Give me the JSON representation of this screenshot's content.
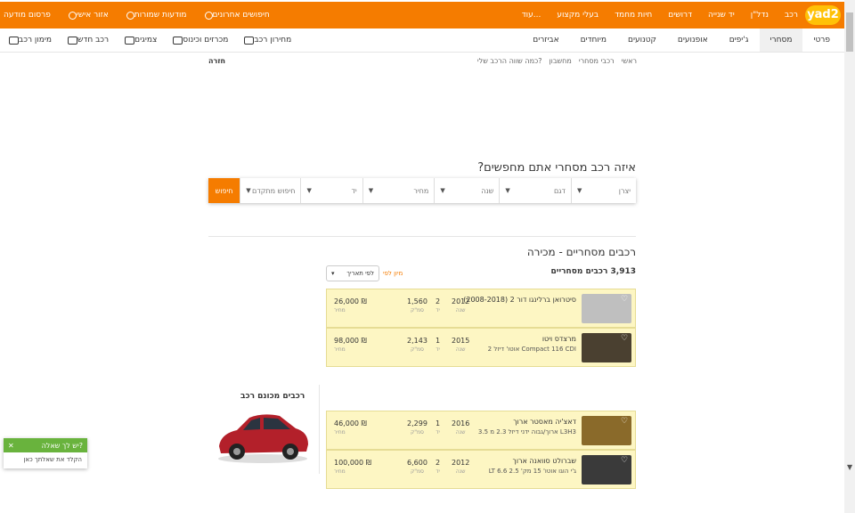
{
  "topbar": {
    "logo": "yad2",
    "nav": [
      "רכב",
      "נדל\"ן",
      "יד שנייה",
      "דרושים",
      "חיות מחמד",
      "בעלי מקצוע",
      "עוד..."
    ],
    "left": [
      {
        "label": "פרסום מודעה",
        "icon": "plus-icon"
      },
      {
        "label": "אזור אישי",
        "icon": "user-icon"
      },
      {
        "label": "מודעות שמורות",
        "icon": "heart-icon"
      },
      {
        "label": "חיפושים אחרונים",
        "icon": "history-icon"
      }
    ]
  },
  "subnav": {
    "tabs": [
      "פרטי",
      "מסחרי",
      "ג'יפים",
      "אופנועים",
      "קטנועים",
      "מיוחדים",
      "אביזרים"
    ],
    "active": 1,
    "tools": [
      {
        "label": "מימון רכב",
        "icon": "calculator-icon"
      },
      {
        "label": "רכב חדש",
        "icon": "car-icon"
      },
      {
        "label": "צמיגים",
        "icon": "tire-icon"
      },
      {
        "label": "מכרזים וכינוס",
        "icon": "gavel-icon"
      },
      {
        "label": "מחירון רכב",
        "icon": "pricelist-icon"
      }
    ]
  },
  "breadcrumb": [
    "ראשי",
    "רכבי מסחרי",
    "מחשבון",
    "כמה שווה הרכב שלי?"
  ],
  "back": "חזרה",
  "search": {
    "title": "איזה רכב מסחרי אתם מחפשים?",
    "fields": [
      {
        "label": "יצרן",
        "value": ""
      },
      {
        "label": "דגם",
        "value": ""
      },
      {
        "label": "שנה",
        "value": ""
      },
      {
        "label": "מחיר",
        "value": ""
      },
      {
        "label": "יד",
        "value": ""
      },
      {
        "label": "חיפוש מתקדם",
        "value": ""
      }
    ],
    "button": "חיפוש"
  },
  "results": {
    "title": "רכבים מסחריים - מכירה",
    "count": "3,913 רכבים מסחריים",
    "sort_label": "מיון לפי",
    "sort_value": "לפי תאריך",
    "items": [
      {
        "title": "סיטרואן ברלינגו דור 2 (2008-2018)",
        "subtitle": "",
        "year": "2012",
        "year_l": "שנה",
        "hand": "2",
        "hand_l": "יד",
        "km": "1,560",
        "km_l": "סמ\"ק",
        "price": "26,000 ₪",
        "price_l": "מחיר",
        "img": "#bfbfbf",
        "yellow": true
      },
      {
        "title": "מרצדס ויטו",
        "subtitle": "Compact 116 CDI אוטו' דיזל 2",
        "year": "2015",
        "year_l": "שנה",
        "hand": "1",
        "hand_l": "יד",
        "km": "2,143",
        "km_l": "סמ\"ק",
        "price": "98,000 ₪",
        "price_l": "מחיר",
        "img": "#4a4030",
        "yellow": true
      },
      {
        "title": "דאצ'יה מאסטר ארוך",
        "subtitle": "L3H3 ארוך/גבוה ידני דיזל 2.3 מ 3.5",
        "year": "2016",
        "year_l": "שנה",
        "hand": "1",
        "hand_l": "יד",
        "km": "2,299",
        "km_l": "סמ\"ק",
        "price": "46,000 ₪",
        "price_l": "מחיר",
        "img": "#8a6a2a",
        "yellow": true
      },
      {
        "title": "שברולט סוואנה ארוך",
        "subtitle": "ג'י הוגו אוטו' 15 מק' 2.5 6.6 LT",
        "year": "2012",
        "year_l": "שנה",
        "hand": "2",
        "hand_l": "יד",
        "km": "6,600",
        "km_l": "סמ\"ק",
        "price": "100,000 ₪",
        "price_l": "מחיר",
        "img": "#3a3a3a",
        "yellow": true
      }
    ]
  },
  "featured": {
    "title": "רכבים מכונם רכב"
  },
  "chat": {
    "head": "יש לך שאלה?",
    "body": "הקלד את שאלתך כאן"
  },
  "colors": {
    "brand": "#f57c00",
    "logo": "#ffc107",
    "highlight": "#fdf6c3",
    "chat": "#69b33d"
  }
}
